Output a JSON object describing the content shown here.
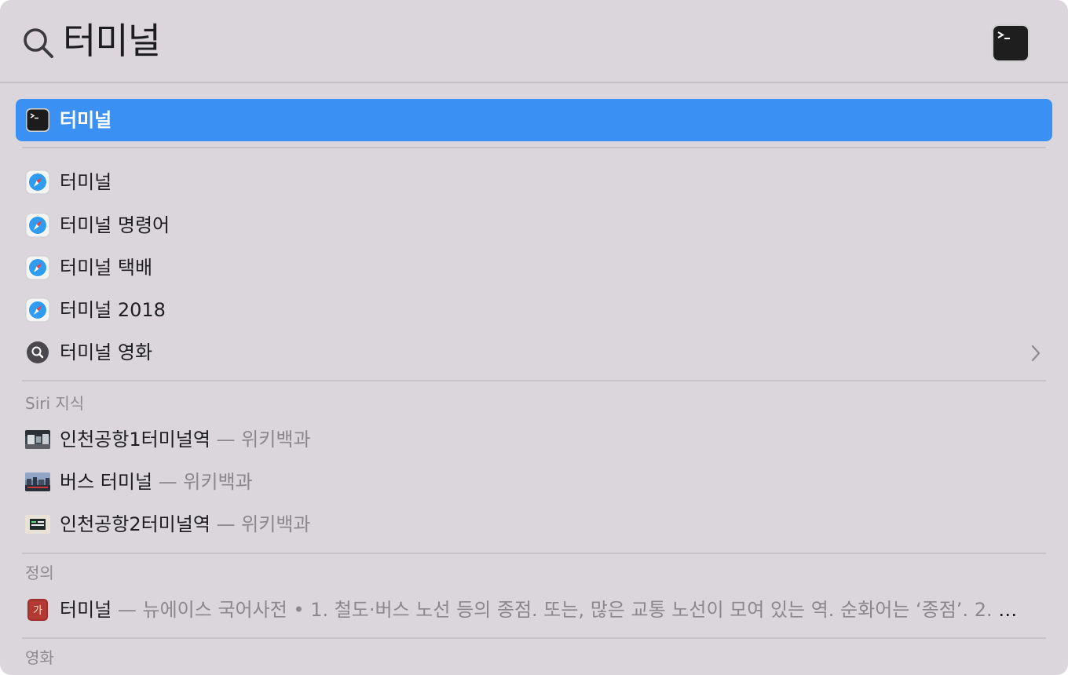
{
  "search": {
    "query": "터미널"
  },
  "top_hit": {
    "label": "터미널",
    "icon": "terminal-app-icon"
  },
  "web_suggestions": [
    {
      "label": "터미널",
      "icon": "safari-icon"
    },
    {
      "label": "터미널 명령어",
      "icon": "safari-icon"
    },
    {
      "label": "터미널 택배",
      "icon": "safari-icon"
    },
    {
      "label": "터미널 2018",
      "icon": "safari-icon"
    },
    {
      "label": "터미널 영화",
      "icon": "search-icon"
    }
  ],
  "siri": {
    "header": "Siri 지식",
    "items": [
      {
        "title": "인천공항1터미널역",
        "source": " — 위키백과"
      },
      {
        "title": "버스 터미널",
        "source": " — 위키백과"
      },
      {
        "title": "인천공항2터미널역",
        "source": " — 위키백과"
      }
    ]
  },
  "definition": {
    "header": "정의",
    "title": "터미널",
    "detail": " — 뉴에이스 국어사전 • 1. 철도·버스 노선 등의 종점. 또는, 많은 교통 노선이 모여 있는 역. 순화어는 ‘종점’. 2. 여러..."
  },
  "movie": {
    "header": "영화"
  },
  "colors": {
    "selection": "#3a91f3",
    "panel": "#dad6dc"
  }
}
